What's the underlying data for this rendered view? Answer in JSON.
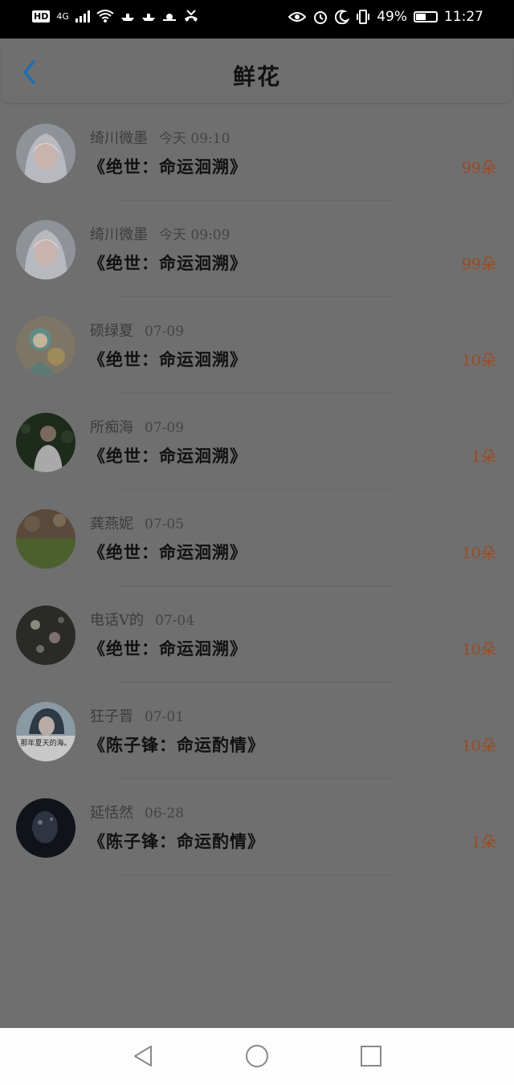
{
  "status_bar": {
    "network": "4G",
    "battery": "49%",
    "time": "11:27"
  },
  "header": {
    "title": "鲜花"
  },
  "items": [
    {
      "name": "绮川微墨",
      "time": "今天 09:10",
      "book": "《绝世：命运洄溯》",
      "count": "99朵"
    },
    {
      "name": "绮川微墨",
      "time": "今天 09:09",
      "book": "《绝世：命运洄溯》",
      "count": "99朵"
    },
    {
      "name": "硕绿夏",
      "time": "07-09",
      "book": "《绝世：命运洄溯》",
      "count": "10朵"
    },
    {
      "name": "所痴海",
      "time": "07-09",
      "book": "《绝世：命运洄溯》",
      "count": "1朵"
    },
    {
      "name": "龚燕妮",
      "time": "07-05",
      "book": "《绝世：命运洄溯》",
      "count": "10朵"
    },
    {
      "name": "电话V的",
      "time": "07-04",
      "book": "《绝世：命运洄溯》",
      "count": "10朵"
    },
    {
      "name": "狂子晋",
      "time": "07-01",
      "book": "《陈子锋：命运酌情》",
      "count": "10朵",
      "avatar_caption": "那年夏天的海。"
    },
    {
      "name": "延恬然",
      "time": "06-28",
      "book": "《陈子锋：命运酌情》",
      "count": "1朵"
    }
  ],
  "colors": {
    "accent": "#1e6fb4",
    "count": "#9b4b22",
    "overlay": "#6f6f6f"
  }
}
